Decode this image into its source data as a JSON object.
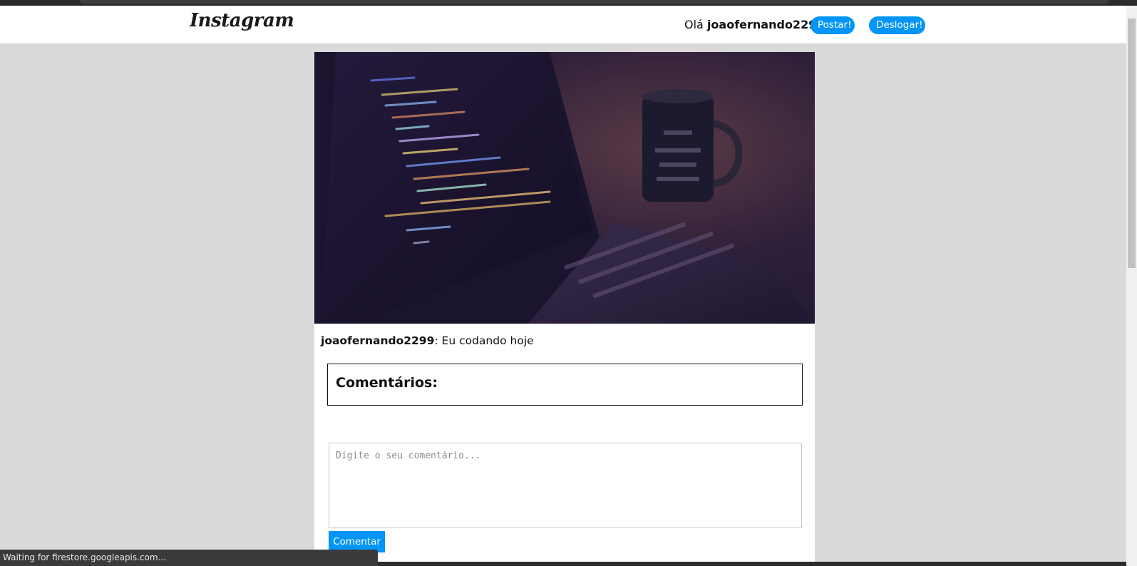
{
  "header": {
    "logo_text": "Instagram",
    "greeting_prefix": "Olá ",
    "username": "joaofernando2299",
    "post_button_label": "Postar!",
    "logout_button_label": "Deslogar!"
  },
  "post": {
    "image_alt": "laptop with code and mug",
    "author": "joaofernando2299",
    "caption_separator": ": ",
    "caption": "Eu codando hoje",
    "comments_title": "Comentários:",
    "comment_placeholder": "Digite o seu comentário...",
    "comment_button_label": "Comentar"
  },
  "status_bar": {
    "text": "Waiting for firestore.googleapis.com..."
  },
  "colors": {
    "accent": "#0095f6",
    "page_background": "#dadada"
  }
}
